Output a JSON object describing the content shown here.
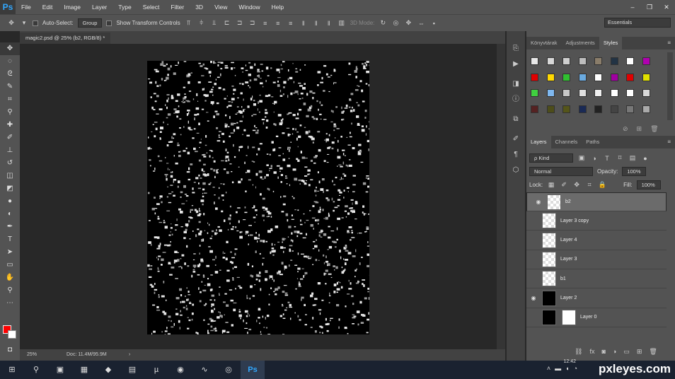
{
  "app": {
    "logo": "Ps"
  },
  "menu": [
    "File",
    "Edit",
    "Image",
    "Layer",
    "Type",
    "Select",
    "Filter",
    "3D",
    "View",
    "Window",
    "Help"
  ],
  "window_controls": [
    "–",
    "❐",
    "✕"
  ],
  "options": {
    "auto_select_label": "Auto-Select:",
    "auto_select_value": "Group",
    "show_transform_label": "Show Transform Controls",
    "mode_3d_label": "3D Mode:",
    "workspace": "Essentials"
  },
  "document": {
    "tab_title": "magic2.psd @ 25% (b2, RGB/8) *",
    "zoom": "25%",
    "doc_info": "Doc: 11.4M/95.9M"
  },
  "styles_panel": {
    "tabs": [
      "Könyvtárak",
      "Adjustments",
      "Styles"
    ],
    "active_tab": "Styles",
    "swatch_colors": [
      "#e8e8e8",
      "#d8d8d8",
      "#cfcfcf",
      "#bdbdbd",
      "#8a7d6a",
      "#223344",
      "#ffffff",
      "#b000b0",
      "#e00000",
      "#ffd800",
      "#30c030",
      "#6aaae0",
      "#ffffff",
      "#a000a0",
      "#e00000",
      "#e0e000",
      "#40d040",
      "#7fb8f0",
      "#c8c8c8",
      "#e0e0e0",
      "#f0f0f0",
      "#ffffff",
      "#ffffff",
      "#d8d8d8",
      "#552222",
      "#4d4d1a",
      "#55551a",
      "#1a2a55",
      "#222222",
      "#444444",
      "#777777",
      "#aaaaaa"
    ]
  },
  "layers_panel": {
    "tabs": [
      "Layers",
      "Channels",
      "Paths"
    ],
    "active_tab": "Layers",
    "filter_label": "ρ Kind",
    "blend_mode": "Normal",
    "opacity_label": "Opacity:",
    "opacity_value": "100%",
    "lock_label": "Lock:",
    "fill_label": "Fill:",
    "fill_value": "100%",
    "layers": [
      {
        "name": "b2",
        "visible": true,
        "selected": true
      },
      {
        "name": "Layer 3 copy",
        "visible": false,
        "selected": false
      },
      {
        "name": "Layer 4",
        "visible": false,
        "selected": false
      },
      {
        "name": "Layer 3",
        "visible": false,
        "selected": false
      },
      {
        "name": "b1",
        "visible": false,
        "selected": false
      },
      {
        "name": "Layer 2",
        "visible": true,
        "selected": false
      },
      {
        "name": "Layer 0",
        "visible": false,
        "selected": false
      }
    ]
  },
  "taskbar": {
    "clock": "12:42",
    "watermark": "pxleyes.com",
    "active_app": "Ps"
  }
}
